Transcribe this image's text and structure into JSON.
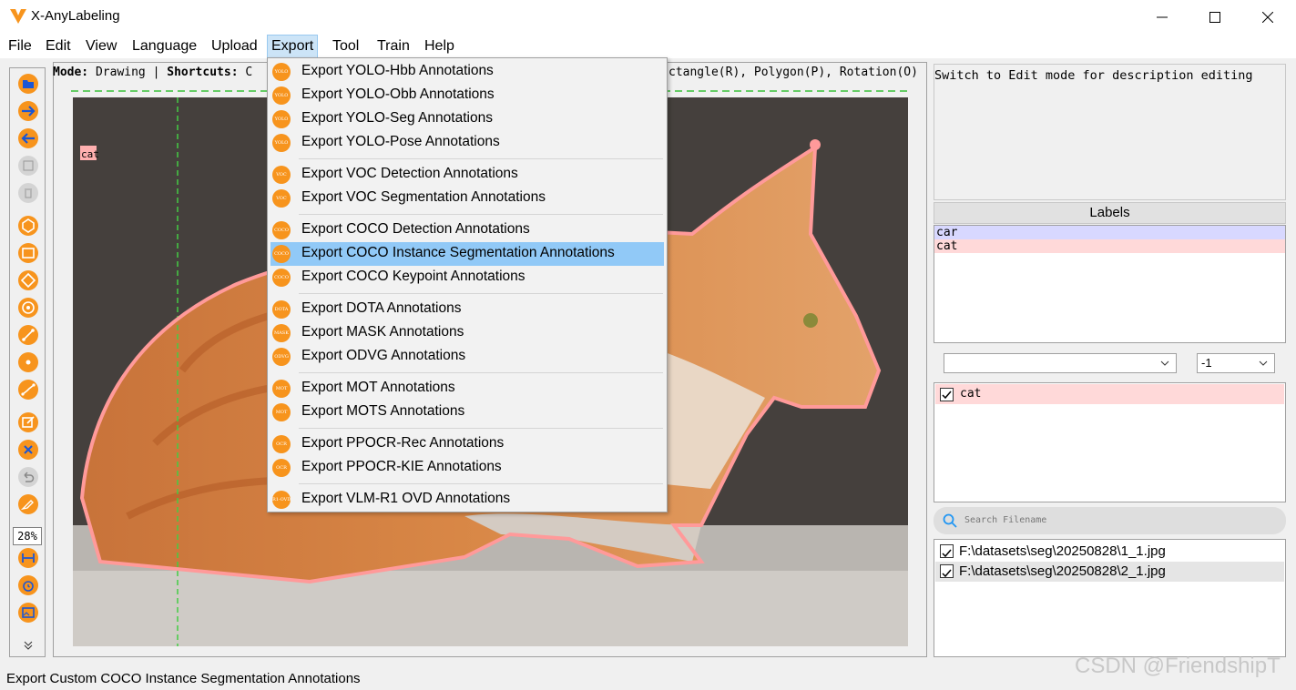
{
  "app": {
    "title": "X-AnyLabeling"
  },
  "menubar": {
    "items": [
      "File",
      "Edit",
      "View",
      "Language",
      "Upload",
      "Export",
      "Tool",
      "Train",
      "Help"
    ],
    "active": "Export"
  },
  "mode_bar": {
    "mode_label": "Mode:",
    "mode_value": "Drawing",
    "shortcuts_label": "Shortcuts:",
    "shortcuts_visible_start": "C",
    "shortcuts_visible_end": "ctangle(R), Polygon(P), Rotation(O)"
  },
  "toolbar": {
    "zoom": "28%"
  },
  "canvas": {
    "shape_label": "cat"
  },
  "description": {
    "hint": "Switch to Edit mode for description editing"
  },
  "labels": {
    "header": "Labels",
    "items": [
      {
        "name": "car",
        "color": "#d8d8ff"
      },
      {
        "name": "cat",
        "color": "#ffd9d9"
      }
    ]
  },
  "filters": {
    "label_combo": "",
    "group_combo": "-1"
  },
  "shapes": {
    "items": [
      {
        "name": "cat",
        "checked": true
      }
    ]
  },
  "search": {
    "placeholder": "Search Filename"
  },
  "files": {
    "items": [
      {
        "path": "F:\\datasets\\seg\\20250828\\1_1.jpg",
        "checked": true
      },
      {
        "path": "F:\\datasets\\seg\\20250828\\2_1.jpg",
        "checked": true
      }
    ]
  },
  "export_menu": {
    "groups": [
      [
        {
          "label": "Export YOLO-Hbb Annotations",
          "icon": "YOLO"
        },
        {
          "label": "Export YOLO-Obb Annotations",
          "icon": "YOLO"
        },
        {
          "label": "Export YOLO-Seg Annotations",
          "icon": "YOLO"
        },
        {
          "label": "Export YOLO-Pose Annotations",
          "icon": "YOLO"
        }
      ],
      [
        {
          "label": "Export VOC Detection Annotations",
          "icon": "VOC"
        },
        {
          "label": "Export VOC Segmentation Annotations",
          "icon": "VOC"
        }
      ],
      [
        {
          "label": "Export COCO Detection Annotations",
          "icon": "COCO"
        },
        {
          "label": "Export COCO Instance Segmentation Annotations",
          "icon": "COCO",
          "highlighted": true
        },
        {
          "label": "Export COCO Keypoint Annotations",
          "icon": "COCO"
        }
      ],
      [
        {
          "label": "Export DOTA Annotations",
          "icon": "DOTA"
        },
        {
          "label": "Export MASK Annotations",
          "icon": "MASK"
        },
        {
          "label": "Export ODVG Annotations",
          "icon": "ODVG"
        }
      ],
      [
        {
          "label": "Export MOT Annotations",
          "icon": "MOT"
        },
        {
          "label": "Export MOTS Annotations",
          "icon": "MOT"
        }
      ],
      [
        {
          "label": "Export PPOCR-Rec Annotations",
          "icon": "OCR"
        },
        {
          "label": "Export PPOCR-KIE Annotations",
          "icon": "OCR"
        }
      ],
      [
        {
          "label": "Export VLM-R1 OVD Annotations",
          "icon": "R1-OVD"
        }
      ]
    ]
  },
  "status": {
    "text": "Export Custom COCO Instance Segmentation Annotations"
  },
  "watermark": "CSDN @FriendshipT",
  "colors": {
    "accent": "#f7941d",
    "highlight": "#91c9f7",
    "shape_outline": "#ff9a9a"
  }
}
